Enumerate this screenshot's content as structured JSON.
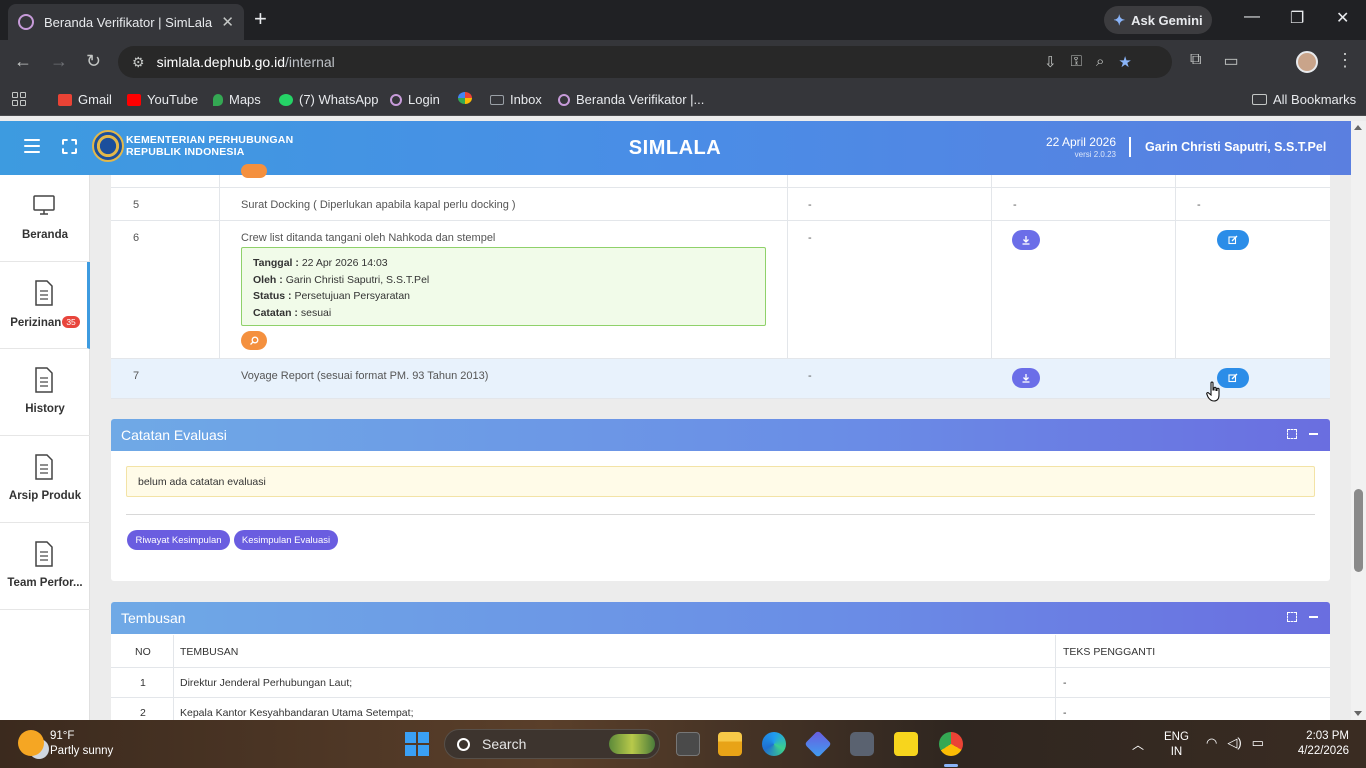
{
  "browser": {
    "tab_title": "Beranda Verifikator | SimLala",
    "new_tab": "+",
    "tab_close": "✕",
    "ask_gemini": "Ask Gemini",
    "url_host": "simlala.dephub.go.id",
    "url_path": "/internal",
    "bookmarks": [
      {
        "label": "Gmail",
        "color": "#ea4335"
      },
      {
        "label": "YouTube",
        "color": "#ff0000"
      },
      {
        "label": "Maps",
        "color": "#34a853"
      },
      {
        "label": "(7) WhatsApp",
        "color": "#25d366"
      },
      {
        "label": "Login",
        "color": "#c79bd9"
      },
      {
        "label": "",
        "color": "#fbbc04"
      },
      {
        "label": "Inbox",
        "color": "#9aa0a6"
      },
      {
        "label": "Beranda Verifikator |...",
        "color": "#c79bd9"
      }
    ],
    "all_bookmarks": "All Bookmarks"
  },
  "header": {
    "ministry_line1": "KEMENTERIAN PERHUBUNGAN",
    "ministry_line2": "REPUBLIK INDONESIA",
    "app_name": "SIMLALA",
    "date": "22 April 2026",
    "version": "versi 2.0.23",
    "separator": "|",
    "user_name": "Garin Christi Saputri, S.S.T.Pel"
  },
  "sidebar": {
    "items": [
      {
        "label": "Beranda",
        "badge": ""
      },
      {
        "label": "Perizinan",
        "badge": "35"
      },
      {
        "label": "History",
        "badge": ""
      },
      {
        "label": "Arsip Produk",
        "badge": ""
      },
      {
        "label": "Team Perfor...",
        "badge": ""
      }
    ]
  },
  "doc_table": {
    "rows": [
      {
        "no": "5",
        "name": "Surat Docking ( Diperlukan apabila kapal perlu docking )",
        "col3": "-",
        "col4": "-",
        "col5": "-"
      },
      {
        "no": "6",
        "name": "Crew list ditanda tangani oleh Nahkoda dan stempel",
        "col3": "-",
        "info": {
          "tanggal_label": "Tanggal :",
          "tanggal": "22 Apr 2026 14:03",
          "oleh_label": "Oleh :",
          "oleh": "Garin Christi Saputri, S.S.T.Pel",
          "status_label": "Status :",
          "status": "Persetujuan Persyaratan",
          "catatan_label": "Catatan :",
          "catatan": "sesuai"
        }
      },
      {
        "no": "7",
        "name": "Voyage Report (sesuai format PM. 93 Tahun 2013)",
        "col3": "-"
      }
    ]
  },
  "evaluasi": {
    "title": "Catatan Evaluasi",
    "note": "belum ada catatan evaluasi",
    "btn_riwayat": "Riwayat Kesimpulan",
    "btn_kesimpulan": "Kesimpulan Evaluasi"
  },
  "tembusan": {
    "title": "Tembusan",
    "col_no": "NO",
    "col_tembusan": "TEMBUSAN",
    "col_teks": "TEKS PENGGANTI",
    "rows": [
      {
        "no": "1",
        "tembusan": "Direktur Jenderal Perhubungan Laut;",
        "teks": "-"
      },
      {
        "no": "2",
        "tembusan": "Kepala Kantor Kesyahbandaran Utama Setempat;",
        "teks": "-"
      }
    ]
  },
  "taskbar": {
    "temp": "91°F",
    "weather": "Partly sunny",
    "search": "Search",
    "lang1": "ENG",
    "lang2": "IN",
    "time": "2:03 PM",
    "date": "4/22/2026"
  },
  "colors": {
    "header_start": "#3d9be0",
    "panel_header": "#6a8de6",
    "download_btn": "#6b6ee8",
    "edit_btn": "#2b8de8",
    "search_btn": "#f4903e",
    "pill_btn": "#6a5de0"
  }
}
